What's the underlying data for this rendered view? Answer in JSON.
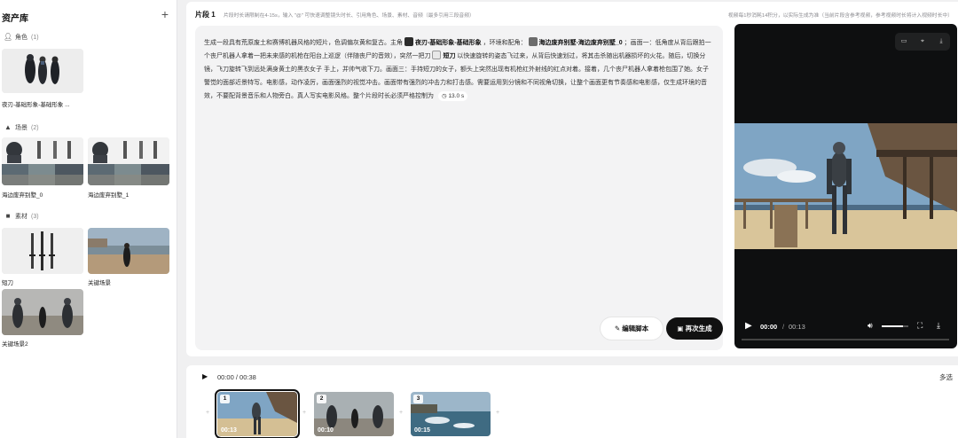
{
  "sidebar": {
    "title": "资产库",
    "add_icon": "plus-icon",
    "sections": {
      "roles": {
        "label": "角色",
        "count": "(1)",
        "icon": "person-icon"
      },
      "scenes": {
        "label": "场景",
        "count": "(2)",
        "icon": "mountain-icon"
      },
      "materials": {
        "label": "素材",
        "count": "(3)",
        "icon": "people-icon"
      }
    },
    "role_items": [
      {
        "caption": "夜刃-基础形象-基础形象 ..."
      }
    ],
    "scene_items": [
      {
        "caption": "海边废弃别墅_0"
      },
      {
        "caption": "海边废弃别墅_1"
      }
    ],
    "material_items": [
      {
        "caption": "短刀"
      },
      {
        "caption": "关键场景"
      },
      {
        "caption": "关键场景2"
      }
    ]
  },
  "segment": {
    "title": "片段 1",
    "tip": "片段时长请限制在4-15s，输入 \"@\" 可快速调整镜头时长、引用角色、场景、素材、音频（最多引用三段音频）",
    "right_note": "视频每1秒消耗14积分，以实际生成为准（当前片段含参考视频，参考视频时长将计入视频时长中）",
    "script": {
      "p1": "生成一段具有荒原废土和赛博机器风格的短片，色调偏灰黄和复古。主角",
      "chip_role": "夜刃-基础形象-基础形象",
      "p2": "，环境和配角：",
      "chip_scene": "海边废弃别墅-海边废弃别墅_0",
      "p3": "；画面一：低角度从背后跟拍一个丧尸机器人拿着一把未来感的机枪在阳台上巡逻（伴随丧尸的音效），突然一把刀",
      "chip_knife": "短刀",
      "p4": "以快速旋转的姿态飞过来，从背后快速划过，将其击杀随出机器损坏的火花。随后，切换分镜，飞刀旋转飞到远处满身黄土的黑衣女子 手上，并帅气收下刀。画面三：手持短刀的女子，额头上突然出现有机枪红外射线的红点对着。接着，几个丧尸机器人拿着枪包围了她。女子警觉的面部近景特写。电影感，动作凌厉，画面强烈的视觉冲击。画面带有强烈的冲击力和打击感。需要运用到分镜和不同视角切换，让整个画面更有节奏感和电影感，仅生成环境的音效，不要配背景音乐和人物旁白。真人写实电影风格。整个片段时长必须严格控制为",
      "duration_chip": "13.0 s"
    },
    "edit_button": "编辑脚本",
    "regen_button": "再次生成"
  },
  "player": {
    "current_time": "00:00",
    "separator": "/",
    "total_time": "00:13",
    "volume_level": 0.8,
    "icons": [
      "comment-icon",
      "crop-icon",
      "download-icon",
      "play-icon",
      "volume-icon",
      "fullscreen-icon"
    ]
  },
  "timeline": {
    "time": "00:00 / 00:38",
    "multi_select": "多选",
    "clips": [
      {
        "number": "1",
        "duration": "00:13"
      },
      {
        "number": "2",
        "duration": "00:10"
      },
      {
        "number": "3",
        "duration": "00:15"
      }
    ]
  }
}
